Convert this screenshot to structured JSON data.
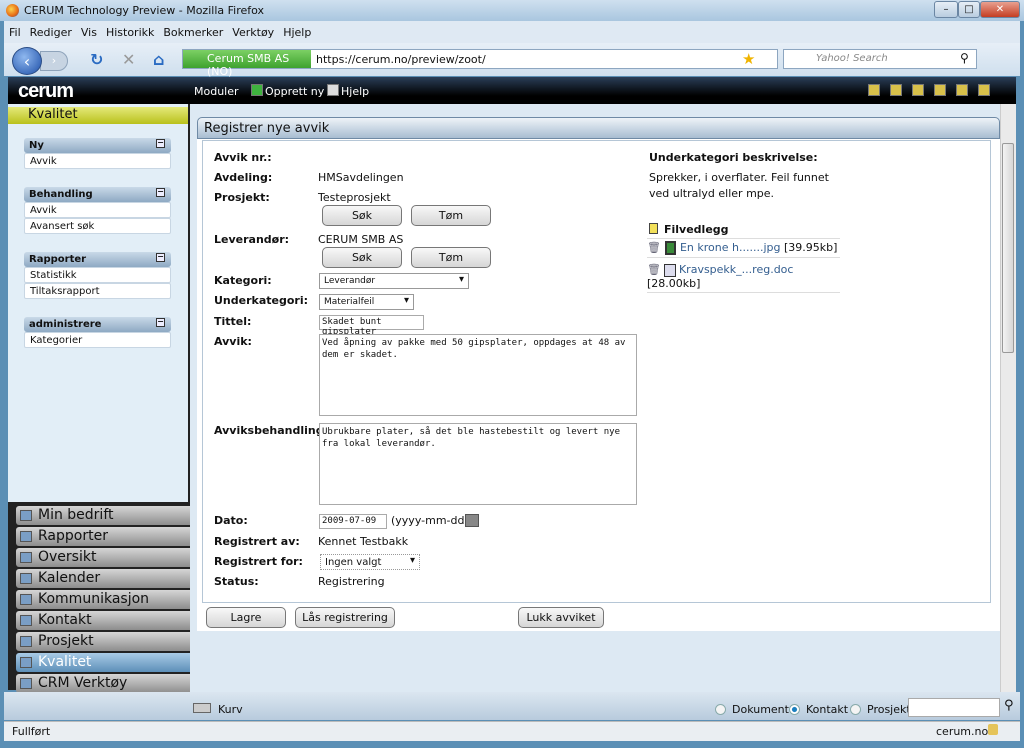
{
  "window": {
    "title": "CERUM Technology Preview - Mozilla Firefox"
  },
  "menu": [
    "Fil",
    "Rediger",
    "Vis",
    "Historikk",
    "Bokmerker",
    "Verktøy",
    "Hjelp"
  ],
  "address": {
    "identity": "Cerum SMB AS (NO)",
    "url": "https://cerum.no/preview/zoot/"
  },
  "search": {
    "placeholder": "Yahoo! Search"
  },
  "app": {
    "logo": "cerum",
    "nav": {
      "modules": "Moduler",
      "create": "Opprett ny",
      "help": "Hjelp"
    }
  },
  "sidebar": {
    "module_title": "Kvalitet",
    "groups": [
      {
        "title": "Ny",
        "items": [
          "Avvik"
        ]
      },
      {
        "title": "Behandling",
        "items": [
          "Avvik",
          "Avansert søk"
        ]
      },
      {
        "title": "Rapporter",
        "items": [
          "Statistikk",
          "Tiltaksrapport"
        ]
      },
      {
        "title": "administrere",
        "items": [
          "Kategorier"
        ]
      }
    ],
    "modules": [
      "Min bedrift",
      "Rapporter",
      "Oversikt",
      "Kalender",
      "Kommunikasjon",
      "Kontakt",
      "Prosjekt",
      "Kvalitet",
      "CRM Verktøy"
    ],
    "active_module": "Kvalitet"
  },
  "form": {
    "title": "Registrer nye avvik",
    "labels": {
      "nr": "Avvik nr.:",
      "avdeling": "Avdeling:",
      "prosjekt": "Prosjekt:",
      "leverandor": "Leverandør:",
      "kategori": "Kategori:",
      "underkategori": "Underkategori:",
      "tittel": "Tittel:",
      "avvik": "Avvik:",
      "behandling": "Avviksbehandling:",
      "dato": "Dato:",
      "regav": "Registrert av:",
      "regfor": "Registrert for:",
      "status": "Status:"
    },
    "values": {
      "nr": "",
      "avdeling": "HMSavdelingen",
      "prosjekt": "Testeprosjekt",
      "leverandor": "CERUM SMB AS",
      "kategori": "Leverandør",
      "underkategori": "Materialfeil",
      "tittel": "Skadet bunt gipsplater",
      "avvik": "Ved åpning av pakke med 50 gipsplater, oppdages at 48 av dem er skadet.",
      "behandling": "Ubrukbare plater, så det ble hastebestilt og levert nye fra lokal leverandør.",
      "dato": "2009-07-09",
      "dato_format": "(yyyy-mm-dd)",
      "regav": "Kennet Testbakk",
      "regfor": "Ingen valgt",
      "status": "Registrering"
    },
    "search_btn": "Søk",
    "clear_btn": "Tøm",
    "sub_desc_title": "Underkategori beskrivelse:",
    "sub_desc": "Sprekker, i overflater. Feil funnet ved ultralyd eller mpe.",
    "attachments_title": "Filvedlegg",
    "attachments": [
      {
        "name": "En krone h.......jpg",
        "size": "[39.95kb]"
      },
      {
        "name": "Kravspekk_...reg.doc",
        "size": "[28.00kb]"
      }
    ],
    "buttons": {
      "save": "Lagre",
      "lock": "Lås registrering",
      "close": "Lukk avviket"
    }
  },
  "bottom": {
    "cart": "Kurv",
    "radios": [
      "Dokument",
      "Kontakt",
      "Prosjekt"
    ],
    "selected": "Kontakt"
  },
  "status": {
    "text": "Fullført",
    "domain": "cerum.no"
  }
}
